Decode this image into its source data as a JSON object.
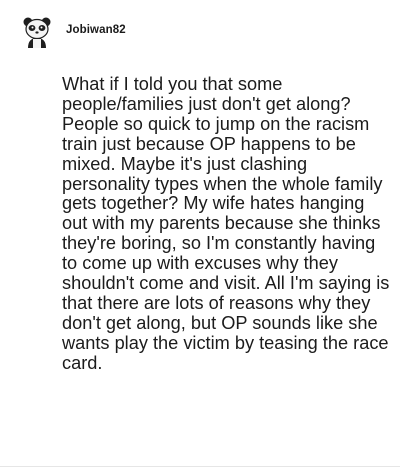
{
  "post": {
    "username": "Jobiwan82",
    "avatar_icon": "panda-avatar-icon",
    "comment_text": "What if I told you that some people/families just don't get along? People so quick to jump on the racism train just because OP happens to be mixed. Maybe it's just clashing personality types when the whole family gets together? My wife hates hanging out with my parents because she thinks they're boring, so I'm constantly having to come up with excuses why they shouldn't come and visit. All I'm saying is that there are lots of reasons why they don't get along, but OP sounds like she wants play the victim by teasing the race card."
  }
}
